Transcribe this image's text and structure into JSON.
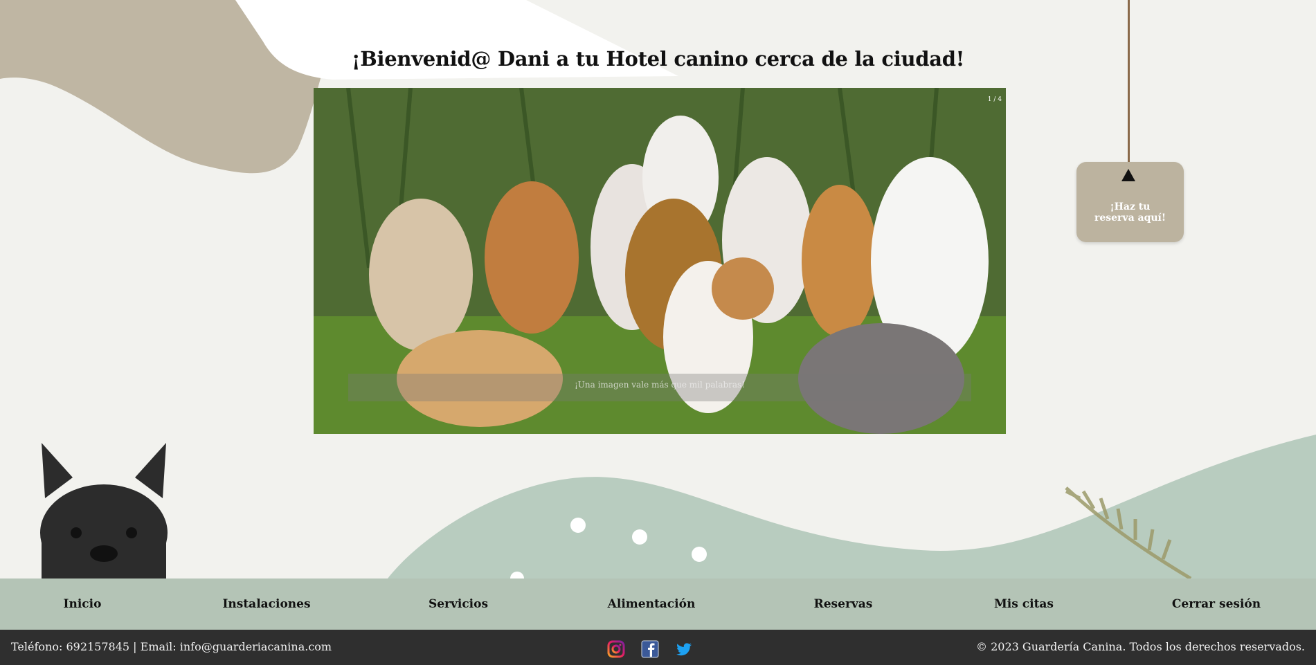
{
  "welcome": {
    "title": "¡Bienvenid@ Dani a tu Hotel canino cerca de la ciudad!"
  },
  "carousel": {
    "counter": "1 / 4",
    "caption": "¡Una imagen vale más que mil palabras!"
  },
  "reserve": {
    "label": "¡Haz tu reserva aquí!"
  },
  "nav": {
    "items": [
      {
        "label": "Inicio"
      },
      {
        "label": "Instalaciones"
      },
      {
        "label": "Servicios"
      },
      {
        "label": "Alimentación"
      },
      {
        "label": "Reservas"
      },
      {
        "label": "Mis citas"
      },
      {
        "label": "Cerrar sesión"
      }
    ]
  },
  "footer": {
    "contact": "Teléfono: 692157845 | Email: info@guarderiacanina.com",
    "copyright": "© 2023 Guardería Canina. Todos los derechos reservados.",
    "social": [
      "instagram-icon",
      "facebook-icon",
      "twitter-icon"
    ]
  },
  "colors": {
    "background": "#f2f2ee",
    "tan": "#bcb39f",
    "sage": "#b4c4b6",
    "footer": "#2f2f2f"
  }
}
